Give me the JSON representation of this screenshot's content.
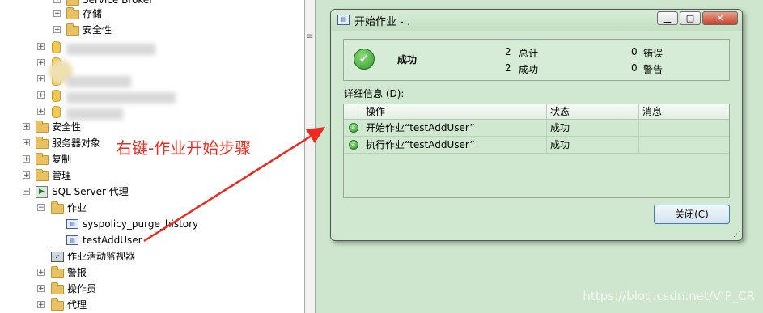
{
  "tree": {
    "items": [
      {
        "label": "Service Broker"
      },
      {
        "label": "存储"
      },
      {
        "label": "安全性"
      },
      {
        "label": "安全性"
      },
      {
        "label": "服务器对象"
      },
      {
        "label": "复制"
      },
      {
        "label": "管理"
      },
      {
        "label": "SQL Server 代理"
      },
      {
        "label": "作业"
      },
      {
        "label": "syspolicy_purge_history"
      },
      {
        "label": "testAddUser"
      },
      {
        "label": "作业活动监视器"
      },
      {
        "label": "警报"
      },
      {
        "label": "操作员"
      },
      {
        "label": "代理"
      }
    ]
  },
  "annotation": {
    "text": "右键-作业开始步骤",
    "color": "#ec2a1f"
  },
  "dialog": {
    "title": "开始作业 - .",
    "status": "成功",
    "stats": {
      "total_count": "2",
      "total_label": "总计",
      "success_count": "2",
      "success_label": "成功",
      "error_count": "0",
      "error_label": "错误",
      "warning_count": "0",
      "warning_label": "警告"
    },
    "details_label": "详细信息 (D):",
    "columns": [
      "操作",
      "状态",
      "消息"
    ],
    "rows": [
      {
        "action": "开始作业“testAddUser”",
        "status": "成功",
        "message": ""
      },
      {
        "action": "执行作业“testAddUser”",
        "status": "成功",
        "message": ""
      }
    ],
    "close_button": "关闭(C)"
  },
  "watermark": "https://blog.csdn.net/VIP_CR",
  "colors": {
    "background": "#cde6cd",
    "accent": "#3c7fb1",
    "annotation": "#ec2a1f"
  }
}
